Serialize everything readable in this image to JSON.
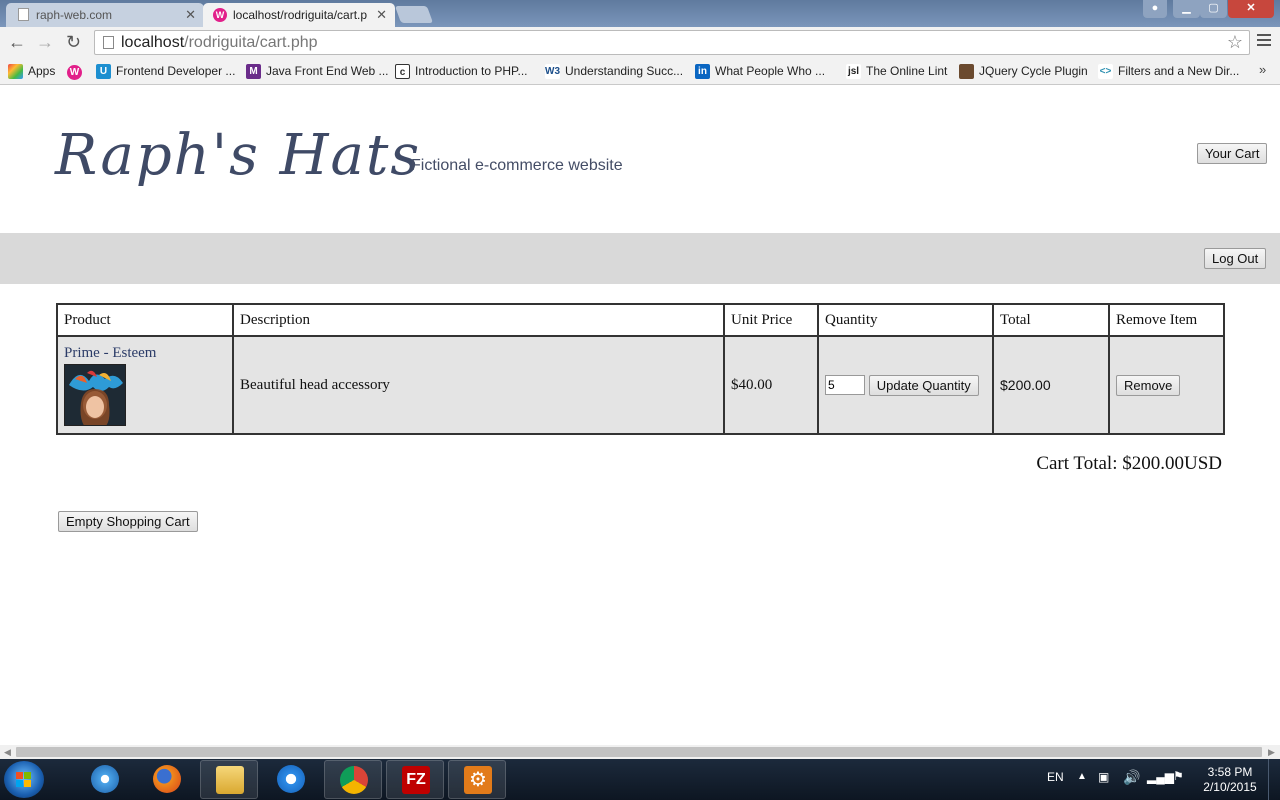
{
  "browser": {
    "tabs": [
      {
        "title": "raph-web.com",
        "active": false
      },
      {
        "title": "localhost/rodriguita/cart.p",
        "active": true
      }
    ],
    "url_host": "localhost",
    "url_path": "/rodriguita/cart.php",
    "bookmarks": [
      {
        "label": "Apps",
        "icon": "apps-grid-icon",
        "color": "#e44"
      },
      {
        "label": "",
        "icon": "w-logo-icon",
        "color": "#e21f8a"
      },
      {
        "label": "Frontend Developer ...",
        "icon": "bookmark-u-icon",
        "color": "#1d8fd0"
      },
      {
        "label": "Java Front End Web ...",
        "icon": "bookmark-m-icon",
        "color": "#6a2c8a"
      },
      {
        "label": "Introduction to PHP...",
        "icon": "bookmark-c-icon",
        "color": "#333333"
      },
      {
        "label": "Understanding Succ...",
        "icon": "bookmark-w3-icon",
        "color": "#1b4e8a"
      },
      {
        "label": "What People Who ...",
        "icon": "linkedin-icon",
        "color": "#0a66c2"
      },
      {
        "label": "The Online Lint",
        "icon": "jsl-icon",
        "color": "#222222"
      },
      {
        "label": "JQuery Cycle Plugin",
        "icon": "photo-bookmark-icon",
        "color": "#6b4a2f"
      },
      {
        "label": "Filters and a New Dir...",
        "icon": "code-bracket-icon",
        "color": "#2b8fb0"
      }
    ],
    "more_bookmarks": "»"
  },
  "site": {
    "logo": "Raph's Hats",
    "tagline": "Fictional e-commerce website",
    "cart_button": "Your Cart",
    "logout_button": "Log Out"
  },
  "cart": {
    "columns": [
      "Product",
      "Description",
      "Unit Price",
      "Quantity",
      "Total",
      "Remove Item"
    ],
    "items": [
      {
        "product": "Prime - Esteem",
        "description": "Beautiful head accessory",
        "unit_price": "$40.00",
        "quantity": "5",
        "update_label": "Update Quantity",
        "total": "$200.00",
        "remove_label": "Remove"
      }
    ],
    "cart_total": "Cart Total: $200.00USD",
    "empty_button": "Empty Shopping Cart"
  },
  "taskbar": {
    "language": "EN",
    "time": "3:58 PM",
    "date": "2/10/2015",
    "apps": [
      "safari-icon",
      "firefox-icon",
      "file-explorer-icon",
      "internet-explorer-icon",
      "chrome-icon",
      "filezilla-icon",
      "settings-gear-icon"
    ]
  }
}
